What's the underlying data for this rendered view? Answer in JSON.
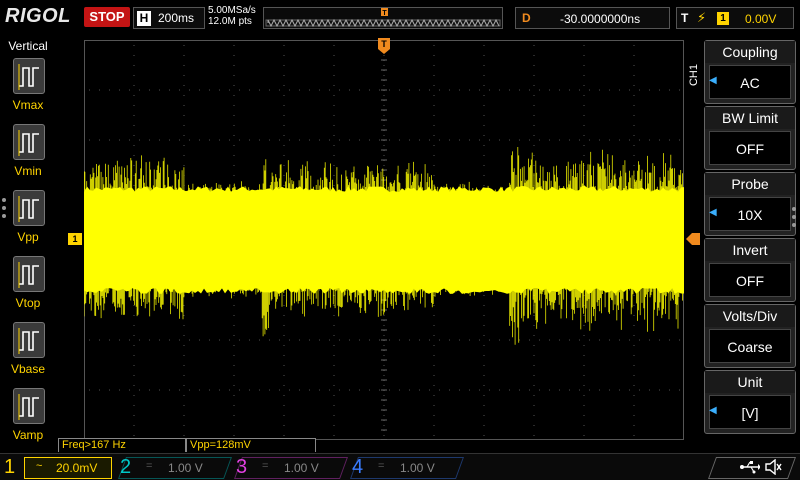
{
  "topbar": {
    "brand": "RIGOL",
    "run_state": "STOP",
    "timebase_label": "H",
    "timebase_value": "200ms",
    "sample_rate": "5.00MSa/s",
    "memory_points": "12.0M pts",
    "delay_label": "D",
    "delay_value": "-30.0000000ns",
    "trigger_label": "T",
    "trigger_source": "1",
    "trigger_level": "0.00V",
    "trigger_marker": "T"
  },
  "left_panel": {
    "title": "Vertical",
    "items": [
      {
        "label": "Vmax",
        "icon": "vmax-icon"
      },
      {
        "label": "Vmin",
        "icon": "vmin-icon"
      },
      {
        "label": "Vpp",
        "icon": "vpp-icon"
      },
      {
        "label": "Vtop",
        "icon": "vtop-icon"
      },
      {
        "label": "Vbase",
        "icon": "vbase-icon"
      },
      {
        "label": "Vamp",
        "icon": "vamp-icon"
      }
    ]
  },
  "right_menu": {
    "channel_tab": "CH1",
    "items": [
      {
        "title": "Coupling",
        "value": "AC",
        "has_knob": true
      },
      {
        "title": "BW Limit",
        "value": "OFF",
        "has_knob": false
      },
      {
        "title": "Probe",
        "value": "10X",
        "has_knob": true
      },
      {
        "title": "Invert",
        "value": "OFF",
        "has_knob": false
      },
      {
        "title": "Volts/Div",
        "value": "Coarse",
        "has_knob": false
      },
      {
        "title": "Unit",
        "value": "[V]",
        "has_knob": true
      }
    ]
  },
  "measurements": {
    "freq": "Freq>167 Hz",
    "vpp": "Vpp=128mV"
  },
  "channels": [
    {
      "num": "1",
      "coupling": "~",
      "scale": "20.0mV",
      "color": "#ffd400",
      "active": true
    },
    {
      "num": "2",
      "coupling": "=",
      "scale": "1.00 V",
      "color": "#00c8c8",
      "active": false
    },
    {
      "num": "3",
      "coupling": "=",
      "scale": "1.00 V",
      "color": "#e040e0",
      "active": false
    },
    {
      "num": "4",
      "coupling": "=",
      "scale": "1.00 V",
      "color": "#3a7cff",
      "active": false
    }
  ],
  "markers": {
    "ch1_ground": "1"
  },
  "colors": {
    "waveform": "#ffff00",
    "accent_yellow": "#ffd400",
    "stop_red": "#c41414",
    "trigger_orange": "#f08a1e",
    "knob_blue": "#3aaefc"
  }
}
